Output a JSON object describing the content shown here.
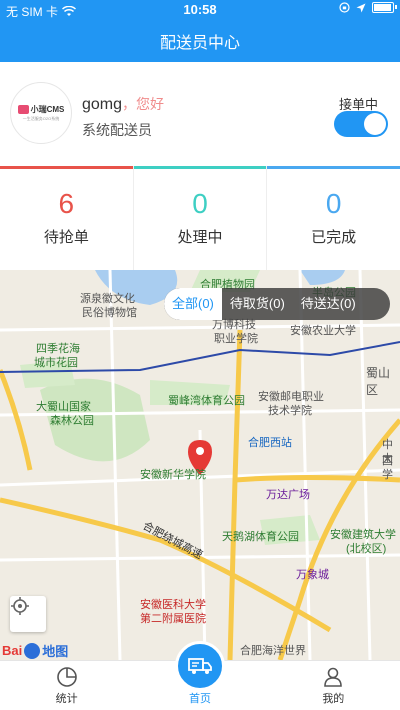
{
  "status_bar": {
    "carrier": "无 SIM 卡",
    "time": "10:58",
    "battery_level": 0.85
  },
  "nav": {
    "title": "配送员中心"
  },
  "profile": {
    "avatar_logo_text": "小瑞CMS",
    "avatar_logo_sub": "一生活服务O2O系统",
    "username": "gomg",
    "greeting": "，您好",
    "role": "系统配送员",
    "accept_label": "接单中",
    "accept_on": true
  },
  "stats": [
    {
      "value": "6",
      "label": "待抢单",
      "color": "#e8534a"
    },
    {
      "value": "0",
      "label": "处理中",
      "color": "#3ecfc3"
    },
    {
      "value": "0",
      "label": "已完成",
      "color": "#4aa8f0"
    }
  ],
  "map": {
    "tabs": [
      "全部(0)",
      "待取货(0)",
      "待送达(0)"
    ],
    "labels": [
      "合肥植物园",
      "半岛公园",
      "源泉徽文化",
      "民俗博物馆",
      "万博科技",
      "职业学院",
      "安徽农业大学",
      "四季花海",
      "城市花园",
      "蜀山区",
      "大蜀山国家",
      "森林公园",
      "蜀峰湾体育公园",
      "安徽邮电职业",
      "技术学院",
      "合肥西站",
      "中国",
      "大学",
      "安徽新华学院",
      "万达广场",
      "合肥绕城高速",
      "天鹅湖体育公园",
      "安徽建筑大学",
      "(北校区)",
      "万象城",
      "安徽医科大学",
      "第二附属医院",
      "合肥海洋世界"
    ],
    "brand_a": "Bai",
    "brand_b": "地图"
  },
  "tabbar": [
    {
      "label": "统计",
      "icon": "pie-chart-icon"
    },
    {
      "label": "首页",
      "icon": "delivery-truck-icon"
    },
    {
      "label": "我的",
      "icon": "user-icon"
    }
  ],
  "colors": {
    "primary": "#2196F3",
    "greeting": "#f08c8c"
  }
}
